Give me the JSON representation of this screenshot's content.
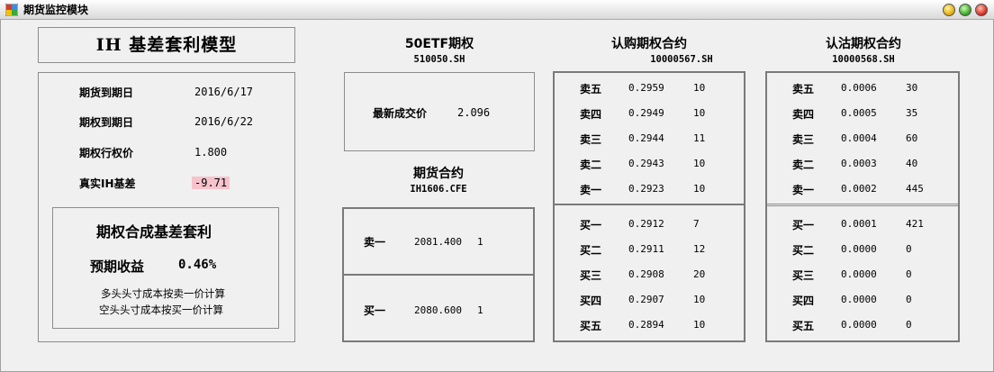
{
  "window": {
    "title": "期货监控模块"
  },
  "model": {
    "title": "IH 基差套利模型",
    "fields": [
      {
        "label": "期货到期日",
        "value": "2016/6/17"
      },
      {
        "label": "期权到期日",
        "value": "2016/6/22"
      },
      {
        "label": "期权行权价",
        "value": "1.800"
      },
      {
        "label": "真实IH基差",
        "value": "-9.71"
      }
    ],
    "arb_title": "期权合成基差套利",
    "yield_label": "预期收益",
    "yield_value": "0.46%",
    "notes": [
      "多头头寸成本按卖一价计算",
      "空头头寸成本按买一价计算"
    ]
  },
  "etf": {
    "title": "50ETF期权",
    "code": "510050.SH",
    "last_label": "最新成交价",
    "last_value": "2.096"
  },
  "futures": {
    "title": "期货合约",
    "code": "IH1606.CFE",
    "ask": {
      "label": "卖一",
      "price": "2081.400",
      "vol": "1"
    },
    "bid": {
      "label": "买一",
      "price": "2080.600",
      "vol": "1"
    }
  },
  "call": {
    "title": "认购期权合约",
    "code": "10000567.SH",
    "asks": [
      {
        "label": "卖五",
        "price": "0.2959",
        "vol": "10"
      },
      {
        "label": "卖四",
        "price": "0.2949",
        "vol": "10"
      },
      {
        "label": "卖三",
        "price": "0.2944",
        "vol": "11"
      },
      {
        "label": "卖二",
        "price": "0.2943",
        "vol": "10"
      },
      {
        "label": "卖一",
        "price": "0.2923",
        "vol": "10"
      }
    ],
    "bids": [
      {
        "label": "买一",
        "price": "0.2912",
        "vol": "7"
      },
      {
        "label": "买二",
        "price": "0.2911",
        "vol": "12"
      },
      {
        "label": "买三",
        "price": "0.2908",
        "vol": "20"
      },
      {
        "label": "买四",
        "price": "0.2907",
        "vol": "10"
      },
      {
        "label": "买五",
        "price": "0.2894",
        "vol": "10"
      }
    ]
  },
  "put": {
    "title": "认沽期权合约",
    "code": "10000568.SH",
    "asks": [
      {
        "label": "卖五",
        "price": "0.0006",
        "vol": "30"
      },
      {
        "label": "卖四",
        "price": "0.0005",
        "vol": "35"
      },
      {
        "label": "卖三",
        "price": "0.0004",
        "vol": "60"
      },
      {
        "label": "卖二",
        "price": "0.0003",
        "vol": "40"
      },
      {
        "label": "卖一",
        "price": "0.0002",
        "vol": "445"
      }
    ],
    "bids": [
      {
        "label": "买一",
        "price": "0.0001",
        "vol": "421"
      },
      {
        "label": "买二",
        "price": "0.0000",
        "vol": "0"
      },
      {
        "label": "买三",
        "price": "0.0000",
        "vol": "0"
      },
      {
        "label": "买四",
        "price": "0.0000",
        "vol": "0"
      },
      {
        "label": "买五",
        "price": "0.0000",
        "vol": "0"
      }
    ]
  },
  "colors": {
    "basis_highlight": "#f6c3cd",
    "background": "#f0f0f0"
  }
}
